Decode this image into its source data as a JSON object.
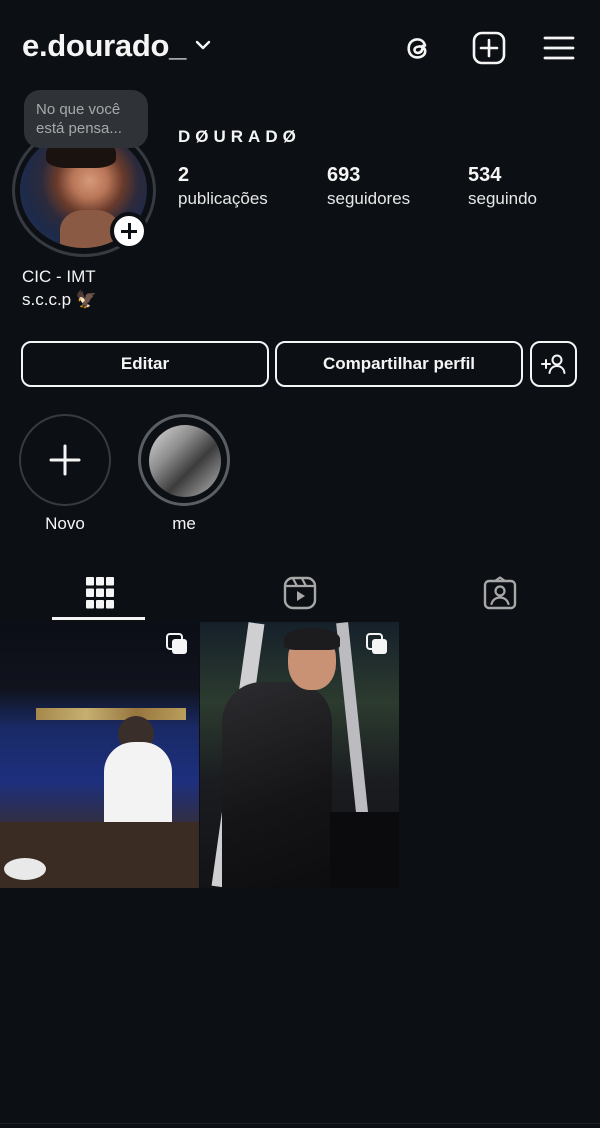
{
  "header": {
    "username": "e.dourado_",
    "icons": [
      "chevron-down-icon",
      "threads-icon",
      "add-post-icon",
      "menu-icon"
    ]
  },
  "note": {
    "placeholder": "No que você está pensa..."
  },
  "profile": {
    "display_name": "DØURADØ",
    "stats": [
      {
        "value": "2",
        "label": "publicações"
      },
      {
        "value": "693",
        "label": "seguidores"
      },
      {
        "value": "534",
        "label": "seguindo"
      }
    ],
    "bio": [
      "CIC - IMT",
      "s.c.c.p 🦅"
    ]
  },
  "actions": {
    "edit_label": "Editar",
    "share_label": "Compartilhar perfil",
    "discover_icon": "add-person-icon"
  },
  "highlights": [
    {
      "label": "Novo"
    },
    {
      "label": "me"
    }
  ],
  "tabs": [
    {
      "icon": "grid-icon",
      "active": true
    },
    {
      "icon": "reels-icon",
      "active": false
    },
    {
      "icon": "tagged-icon",
      "active": false
    }
  ],
  "posts": [
    {
      "type": "carousel"
    },
    {
      "type": "carousel"
    }
  ],
  "colors": {
    "background": "#0c1014",
    "text": "#f5f5f5",
    "border": "#363b42",
    "note_bg": "#2f3338"
  }
}
